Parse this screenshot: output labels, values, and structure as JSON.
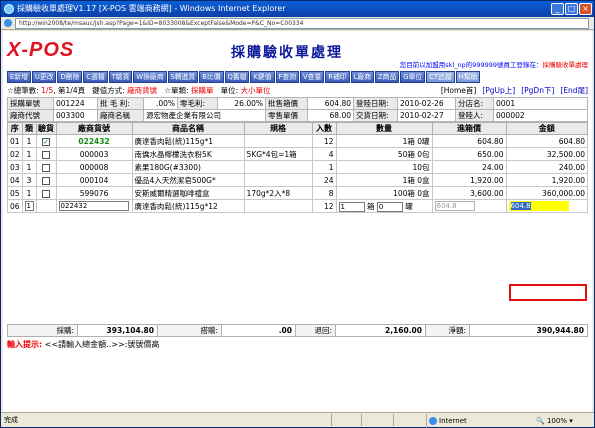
{
  "window": {
    "title": "採購驗收單處理V1.17 [X-POS 雲端商務網] - Windows Internet Explorer",
    "url": "http://win2008/te/msauc/jsh.asp?Page=1&ID=8033008&ExceptFalse&Mode=P&C_No=C00334"
  },
  "header": {
    "logo": "X-POS",
    "title": "採購驗收單處理",
    "notice_prefix": "您目前以加盟用skl_np的999999號員工登錄在",
    "notice_module": "採購驗收單處理"
  },
  "toolbar": [
    "E新增",
    "U更改",
    "D刪除",
    "C選檔",
    "T驗貨",
    "W換廠商",
    "S轉進貨",
    "B比價",
    "Q舊檔",
    "K鍵值",
    "F查詢",
    "V查量",
    "R補印",
    "L廠商",
    "Z商品",
    "G單位",
    "CT追蹤",
    "H幫助"
  ],
  "summary": {
    "total_label": "☆總筆數",
    "total_value": "1/5",
    "page_text": "第1/4頁",
    "mode_label": "鍵值方式",
    "mode_value": "廠商貨號",
    "order_label": "☆單類",
    "order_value": "採購單",
    "unit_label": "單位",
    "unit_value": "大小單位",
    "nav": [
      "[Home首]",
      "[PgUp上]",
      "[PgDn下]",
      "[End尾]"
    ]
  },
  "info": {
    "r1": [
      "採購單號",
      "001224",
      "批 毛 利:",
      ".00%",
      "零毛利:",
      "26.00%",
      "批售箱價",
      "604.80",
      "登陸日期:",
      "2010-02-26",
      "分店名:",
      "0001"
    ],
    "r2": [
      "廠商代號",
      "003300",
      "廠商名稱",
      "源宏物產企業有限公司",
      "零售單價",
      "68.00",
      "交貨日期:",
      "2010-02-27",
      "登陸人:",
      "000002"
    ]
  },
  "grid": {
    "headers": [
      "序",
      "類",
      "驗貨",
      "廠商貨號",
      "商品名稱",
      "規格",
      "入數",
      "數量",
      "進箱價",
      "金額"
    ],
    "rows": [
      {
        "seq": "01",
        "type": "1",
        "checked": true,
        "code": "022432",
        "name": "廣達香肉鬆(統)115g*1",
        "spec": "",
        "pack": "12",
        "qty": "1箱",
        "loose": "0罐",
        "price": "604.80",
        "amount": "604.80"
      },
      {
        "seq": "02",
        "type": "1",
        "checked": false,
        "code": "000003",
        "name": "南僑水晶檸檬洗衣粉5K",
        "spec": "5KG*4包=1箱",
        "pack": "4",
        "qty": "50箱",
        "loose": "0包",
        "price": "650.00",
        "amount": "32,500.00"
      },
      {
        "seq": "03",
        "type": "1",
        "checked": false,
        "code": "000008",
        "name": "素果180G(#3300)",
        "spec": "",
        "pack": "1",
        "qty": "",
        "loose": "10包",
        "price": "24.00",
        "amount": "240.00"
      },
      {
        "seq": "04",
        "type": "3",
        "checked": false,
        "code": "000104",
        "name": "優品4入天然潔皂500G*",
        "spec": "",
        "pack": "24",
        "qty": "1箱",
        "loose": "0盒",
        "price": "1,920.00",
        "amount": "1,920.00"
      },
      {
        "seq": "05",
        "type": "1",
        "checked": false,
        "code": "599076",
        "name": "安斯威爾精選咖啡禮盒",
        "spec": "170g*2入*8",
        "pack": "8",
        "qty": "100箱",
        "loose": "0盒",
        "price": "3,600.00",
        "amount": "360,000.00"
      }
    ],
    "edit_row": {
      "seq": "06",
      "type": "1",
      "code": "022432",
      "name": "廣達香肉鬆(統)115g*12",
      "pack": "12",
      "qty": "1",
      "qty_unit": "箱",
      "loose": "0",
      "loose_unit": "罐",
      "price": "604.8",
      "amount": "604.8"
    }
  },
  "footer": {
    "purchase_label": "採購:",
    "purchase_value": "393,104.80",
    "discount_label": "搭贈:",
    "discount_value": ".00",
    "return_label": "退回:",
    "return_value": "2,160.00",
    "net_label": "淨額:",
    "net_value": "390,944.80"
  },
  "hint": {
    "label": "輸入提示:",
    "text": "<<請輸入總金額..>>:號號價高"
  },
  "statusbar": {
    "left": "完成",
    "zone": "Internet",
    "zoom": "100%"
  }
}
